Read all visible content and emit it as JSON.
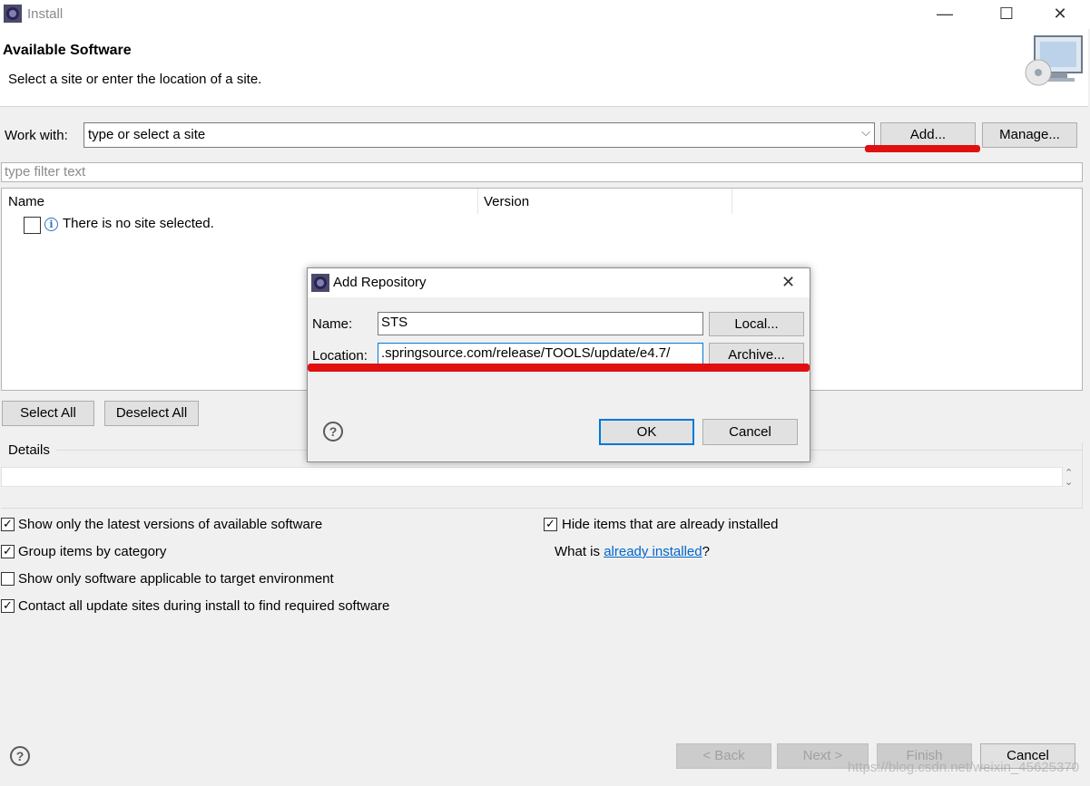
{
  "window": {
    "title": "Install",
    "minimize_icon": "minimize-icon",
    "maximize_icon": "maximize-icon",
    "close_icon": "close-icon"
  },
  "banner": {
    "title": "Available Software",
    "description": "Select a site or enter the location of a site."
  },
  "work_with": {
    "label": "Work with:",
    "value": "type or select a site",
    "add_label": "Add...",
    "manage_label": "Manage..."
  },
  "filter": {
    "placeholder": "type filter text"
  },
  "table": {
    "columns": [
      "Name",
      "Version"
    ],
    "message": "There is no site selected."
  },
  "selection": {
    "select_all": "Select All",
    "deselect_all": "Deselect All"
  },
  "details": {
    "label": "Details"
  },
  "options": {
    "latest_versions": {
      "label": "Show only the latest versions of available software",
      "checked": true
    },
    "group_by_category": {
      "label": "Group items by category",
      "checked": true
    },
    "target_env": {
      "label": "Show only software applicable to target environment",
      "checked": false
    },
    "contact_sites": {
      "label": "Contact all update sites during install to find required software",
      "checked": true
    },
    "hide_installed": {
      "label": "Hide items that are already installed",
      "checked": true
    },
    "what_is_prefix": "What is ",
    "already_installed_link": "already installed",
    "what_is_suffix": "?"
  },
  "footer": {
    "back_label": "< Back",
    "next_label": "Next >",
    "finish_label": "Finish",
    "cancel_label": "Cancel"
  },
  "dialog": {
    "title": "Add Repository",
    "name_label": "Name:",
    "name_value": "STS",
    "location_label": "Location:",
    "location_value": ".springsource.com/release/TOOLS/update/e4.7/",
    "local_label": "Local...",
    "archive_label": "Archive...",
    "ok_label": "OK",
    "cancel_label": "Cancel"
  },
  "watermark": "https://blog.csdn.net/weixin_45625370",
  "colors": {
    "annotation_red": "#e01010",
    "link_blue": "#0066cc",
    "default_button_border": "#0078d7"
  }
}
